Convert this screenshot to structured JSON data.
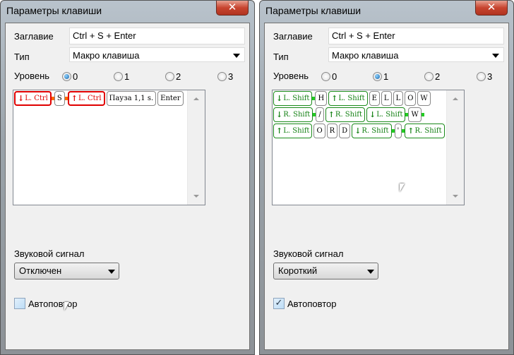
{
  "windows": [
    {
      "title": "Параметры клавиши",
      "caption_label": "Заглавие",
      "caption_value": "Ctrl + S + Enter",
      "type_label": "Тип",
      "type_value": "Макро клавиша",
      "level_label": "Уровень",
      "levels": [
        "0",
        "1",
        "2",
        "3"
      ],
      "level_selected": 0,
      "keys": [
        {
          "text": "L. Ctrl",
          "dir": "down",
          "style": "red",
          "link": "red"
        },
        {
          "text": "S",
          "style": "plain",
          "link": "red"
        },
        {
          "text": "L. Ctrl",
          "dir": "up",
          "style": "red"
        },
        {
          "text": "Пауза 1,1 s.",
          "style": "plain"
        },
        {
          "text": "Enter",
          "style": "plain"
        }
      ],
      "sound_label": "Звуковой сигнал",
      "sound_value": "Отключен",
      "autorepeat_label": "Автоповтор",
      "autorepeat_checked": false
    },
    {
      "title": "Параметры клавиши",
      "caption_label": "Заглавие",
      "caption_value": "Ctrl + S + Enter",
      "type_label": "Тип",
      "type_value": "Макро клавиша",
      "level_label": "Уровень",
      "levels": [
        "0",
        "1",
        "2",
        "3"
      ],
      "level_selected": 1,
      "keys": [
        {
          "text": "L. Shift",
          "dir": "down",
          "style": "green",
          "link": "green"
        },
        {
          "text": "H",
          "style": "plain"
        },
        {
          "text": "L. Shift",
          "dir": "up",
          "style": "green"
        },
        {
          "text": "E",
          "style": "plain"
        },
        {
          "text": "L",
          "style": "plain"
        },
        {
          "text": "L",
          "style": "plain"
        },
        {
          "text": "O",
          "style": "plain"
        },
        {
          "text": "W",
          "style": "plain"
        },
        {
          "text": "R. Shift",
          "dir": "down",
          "style": "green",
          "link": "green"
        },
        {
          "text": "/",
          "style": "plain"
        },
        {
          "text": "R. Shift",
          "dir": "up",
          "style": "green"
        },
        {
          "text": "L. Shift",
          "dir": "down",
          "style": "green",
          "link": "green"
        },
        {
          "text": "W",
          "style": "plain",
          "link": "green"
        },
        {
          "text": "L. Shift",
          "dir": "up",
          "style": "green"
        },
        {
          "text": "O",
          "style": "plain"
        },
        {
          "text": "R",
          "style": "plain"
        },
        {
          "text": "D",
          "style": "plain"
        },
        {
          "text": "R. Shift",
          "dir": "down",
          "style": "green",
          "link": "green"
        },
        {
          "text": "'",
          "style": "plain",
          "link": "green"
        },
        {
          "text": "R. Shift",
          "dir": "up",
          "style": "green"
        }
      ],
      "sound_label": "Звуковой сигнал",
      "sound_value": "Короткий",
      "autorepeat_label": "Автоповтор",
      "autorepeat_checked": true
    }
  ],
  "icons": {
    "close": "close-icon",
    "down_arrow": "↓",
    "up_arrow": "↑",
    "check": "✓"
  },
  "colors": {
    "red_link": "#ff6a00",
    "green_link": "#22cc22",
    "red_key": "#e00000",
    "green_key": "#138013"
  }
}
